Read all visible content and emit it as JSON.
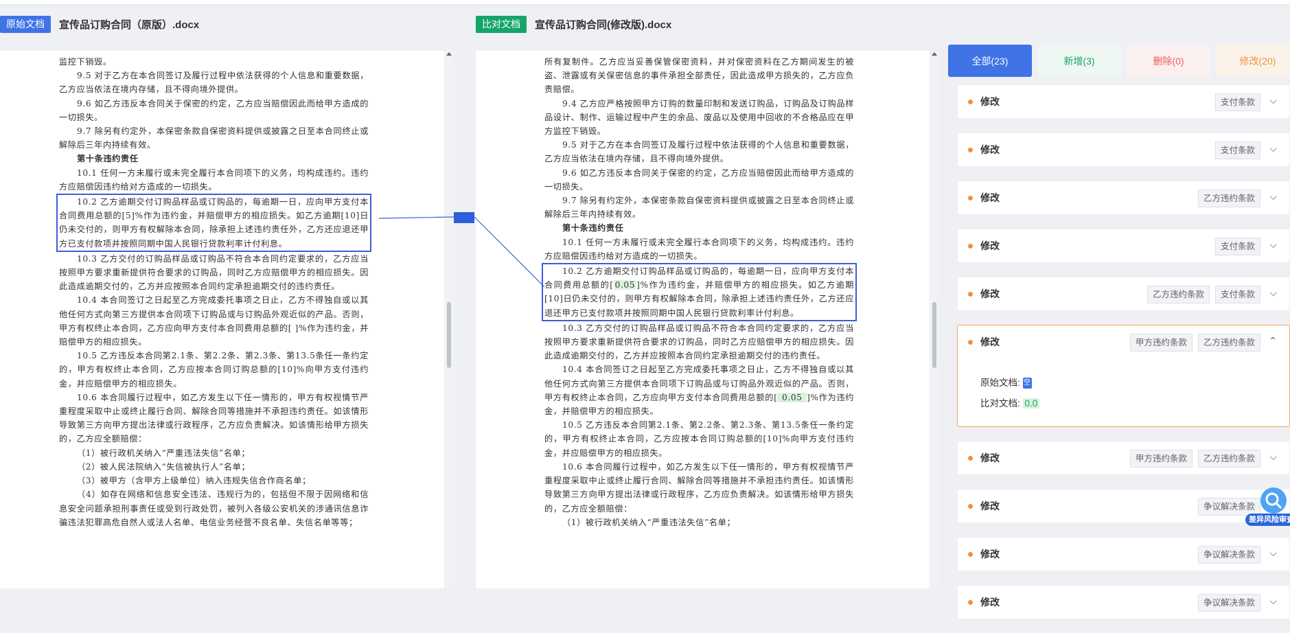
{
  "left_doc": {
    "tag": "原始文档",
    "name": "宣传品订购合同（原版）.docx",
    "paras": [
      "监控下销毁。",
      "9.5 对于乙方在本合同签订及履行过程中依法获得的个人信息和重要数据，乙方应当依法在境内存储，且不得向境外提供。",
      "9.6 如乙方违反本合同关于保密的约定，乙方应当赔偿因此而给甲方造成的一切损失。",
      "9.7 除另有约定外，本保密条款自保密资料提供或披露之日至本合同终止或解除后三年内持续有效。",
      "第十条违约责任",
      "10.1 任何一方未履行或未完全履行本合同项下的义务，均构成违约。违约方应赔偿因违约给对方造成的一切损失。",
      "10.2 乙方逾期交付订购品样品或订购品的，每逾期一日，应向甲方支付本合同费用总额的[5]%作为违约金，并赔偿甲方的相应损失。如乙方逾期[10]日仍未交付的，则甲方有权解除本合同，除承担上述违约责任外，乙方还应退还甲方已支付款项并按照同期中国人民银行贷款利率计付利息。",
      "10.3 乙方交付的订购品样品或订购品不符合本合同约定要求的，乙方应当按照甲方要求重新提供符合要求的订购品，同时乙方应赔偿甲方的相应损失。因此造成逾期交付的，乙方并应按照本合同约定承担逾期交付的违约责任。",
      "10.4 本合同签订之日起至乙方完成委托事项之日止，乙方不得独自或以其他任何方式向第三方提供本合同项下订购品或与订购品外观近似的产品。否则，甲方有权终止本合同，乙方应向甲方支付本合同费用总额的[ ]%作为违约金，并赔偿甲方的相应损失。",
      "10.5 乙方违反本合同第2.1条、第2.2条、第2.3条、第13.5条任一条约定的，甲方有权终止本合同，乙方应按本合同订购总额的[10]%向甲方支付违约金，并应赔偿甲方的相应损失。",
      "10.6 本合同履行过程中，如乙方发生以下任一情形的，甲方有权视情节严重程度采取中止或终止履行合同、解除合同等措施并不承担违约责任。如该情形导致第三方向甲方提出法律或行政程序，乙方应负责解决。如该情形给甲方损失的，乙方应全额赔偿：",
      "（1）被行政机关纳入“严重违法失信”名单；",
      "（2）被人民法院纳入“失信被执行人”名单；",
      "（3）被甲方（含甲方上级单位）纳入违规失信合作商名单；",
      "（4）如存在网络和信息安全违法、违规行为的，包括但不限于因网络和信息安全问题承担刑事责任或受到行政处罚，被列入各级公安机关的涉通讯信息诈骗违法犯罪高危自然人或法人名单、电信业务经营不良名单、失信名单等等；"
    ]
  },
  "right_doc": {
    "tag": "比对文档",
    "name": "宣传品订购合同(修改版).docx",
    "paras": [
      "所有复制件。乙方应当妥善保管保密资料，并对保密资料在乙方期间发生的被盗、泄露或有关保密信息的事件承担全部责任，因此造成甲方损失的，乙方应负责赔偿。",
      "9.4 乙方应严格按照甲方订购的数量印制和发送订购品，订购品及订购品样品设计、制作、运输过程中产生的余品、废品以及使用中回收的不合格品应在甲方监控下销毁。",
      "9.5 对于乙方在本合同签订及履行过程中依法获得的个人信息和重要数据，乙方应当依法在境内存储，且不得向境外提供。",
      "9.6 如乙方违反本合同关于保密的约定，乙方应当赔偿因此而给甲方造成的一切损失。",
      "9.7 除另有约定外，本保密条款自保密资料提供或披露之日至本合同终止或解除后三年内持续有效。",
      "第十条违约责任",
      "10.1 任何一方未履行或未完全履行本合同项下的义务，均构成违约。违约方应赔偿因违约给对方造成的一切损失。",
      "10.3 乙方交付的订购品样品或订购品不符合本合同约定要求的，乙方应当按照甲方要求重新提供符合要求的订购品，同时乙方应赔偿甲方的相应损失。因此造成逾期交付的，乙方并应按照本合同约定承担逾期交付的违约责任。",
      "10.5 乙方违反本合同第2.1条、第2.2条、第2.3条、第13.5条任一条约定的，甲方有权终止本合同，乙方应按本合同订购总额的[10]%向甲方支付违约金，并应赔偿甲方的相应损失。",
      "10.6 本合同履行过程中，如乙方发生以下任一情形的，甲方有权视情节严重程度采取中止或终止履行合同、解除合同等措施并不承担违约责任。如该情形导致第三方向甲方提出法律或行政程序，乙方应负责解决。如该情形给甲方损失的，乙方应全额赔偿：",
      "（1）被行政机关纳入“严重违法失信”名单；"
    ],
    "p102_a": "10.2 乙方逾期交付订购品样品或订购品的，每逾期一日，应向甲方支付本合同费用总额的[",
    "p102_mark": "0.05",
    "p102_b": "]%作为违约金，并赔偿甲方的相应损失。如乙方逾期[10]日仍未交付的，则甲方有权解除本合同，除承担上述违约责任外，乙方还应退还甲方已支付款项并按照同期中国人民银行贷款利率计付利息。",
    "p104_a": "10.4 本合同签订之日起至乙方完成委托事项之日止，乙方不得独自或以其他任何方式向第三方提供本合同项下订购品或与订购品外观近似的产品。否则，甲方有权终止本合同，乙方应向甲方支付本合同费用总额的[",
    "p104_mark": " 0.05 ",
    "p104_b": "]%作为违约金，并赔偿甲方的相应损失。"
  },
  "tabs": {
    "all": "全部(23)",
    "added": "新增(3)",
    "deleted": "删除(0)",
    "modified": "修改(20)"
  },
  "cards": [
    {
      "title": "修改",
      "chips": [
        "支付条款"
      ],
      "chevron": "⌵"
    },
    {
      "title": "修改",
      "chips": [
        "支付条款"
      ],
      "chevron": "⌵"
    },
    {
      "title": "修改",
      "chips": [
        "乙方违约条款"
      ],
      "chevron": "⌵"
    },
    {
      "title": "修改",
      "chips": [
        "支付条款"
      ],
      "chevron": "⌵"
    },
    {
      "title": "修改",
      "chips": [
        "乙方违约条款",
        "支付条款"
      ],
      "chevron": "⌵"
    },
    {
      "title": "修改",
      "chips": [
        "甲方违约条款",
        "乙方违约条款"
      ],
      "chevron": "⌃"
    },
    {
      "title": "修改",
      "chips": [
        "甲方违约条款",
        "乙方违约条款"
      ],
      "chevron": "⌵"
    },
    {
      "title": "修改",
      "chips": [
        "争议解决条款"
      ],
      "chevron": "⌵"
    },
    {
      "title": "修改",
      "chips": [
        "争议解决条款"
      ],
      "chevron": "⌵"
    },
    {
      "title": "修改",
      "chips": [
        "争议解决条款"
      ],
      "chevron": "⌵"
    }
  ],
  "detail": {
    "orig_label": "原始文档:",
    "orig_badge": "空",
    "cmp_label": "比对文档:",
    "cmp_value": "0.0"
  },
  "widget": {
    "label": "差异风险审查"
  },
  "colors": {
    "accent": "#3f73e6",
    "added": "#16a46b",
    "deleted": "#ef5b5b",
    "modified": "#f29135"
  }
}
